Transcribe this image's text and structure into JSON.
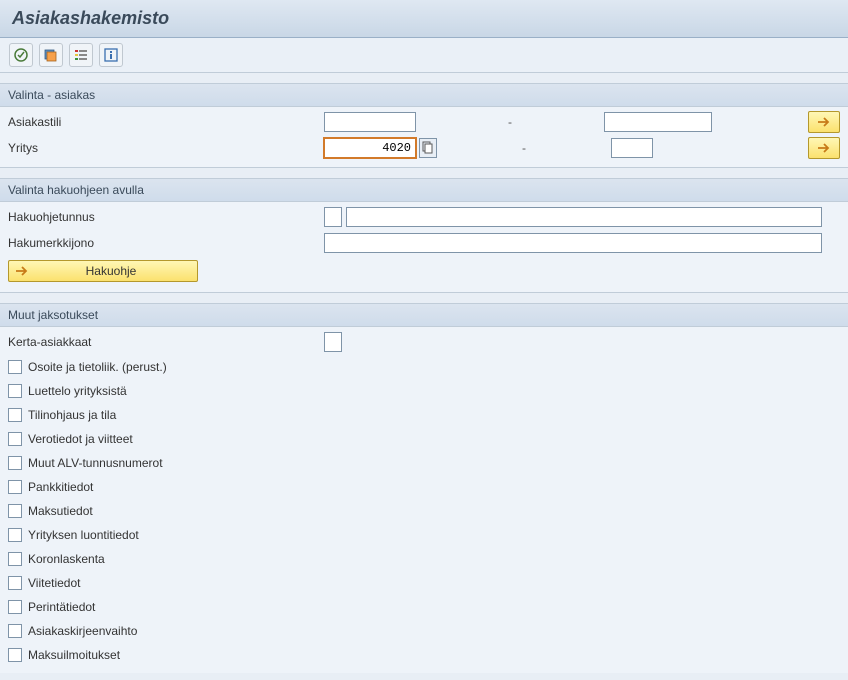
{
  "header": {
    "title": "Asiakashakemisto"
  },
  "toolbar": {
    "execute": "execute",
    "overview": "overview",
    "list": "list",
    "info": "info"
  },
  "section1": {
    "title": "Valinta - asiakas",
    "rows": {
      "asiakastili": {
        "label": "Asiakastili",
        "from": "",
        "to": "",
        "dash": "-"
      },
      "yritys": {
        "label": "Yritys",
        "from": "4020",
        "to": "",
        "dash": "-"
      }
    }
  },
  "section2": {
    "title": "Valinta hakuohjeen avulla",
    "rows": {
      "hakuohjetunnus": {
        "label": "Hakuohjetunnus",
        "flag": "",
        "value": ""
      },
      "hakumerkkijono": {
        "label": "Hakumerkkijono",
        "value": ""
      }
    },
    "button": "Hakuohje"
  },
  "section3": {
    "title": "Muut jaksotukset",
    "kerta": {
      "label": "Kerta-asiakkaat",
      "value": ""
    },
    "checks": [
      "Osoite ja tietoliik. (perust.)",
      "Luettelo yrityksistä",
      "Tilinohjaus ja tila",
      "Verotiedot ja viitteet",
      "Muut ALV-tunnusnumerot",
      "Pankkitiedot",
      "Maksutiedot",
      "Yrityksen luontitiedot",
      "Koronlaskenta",
      "Viitetiedot",
      "Perintätiedot",
      "Asiakaskirjeenvaihto",
      "Maksuilmoitukset"
    ]
  }
}
